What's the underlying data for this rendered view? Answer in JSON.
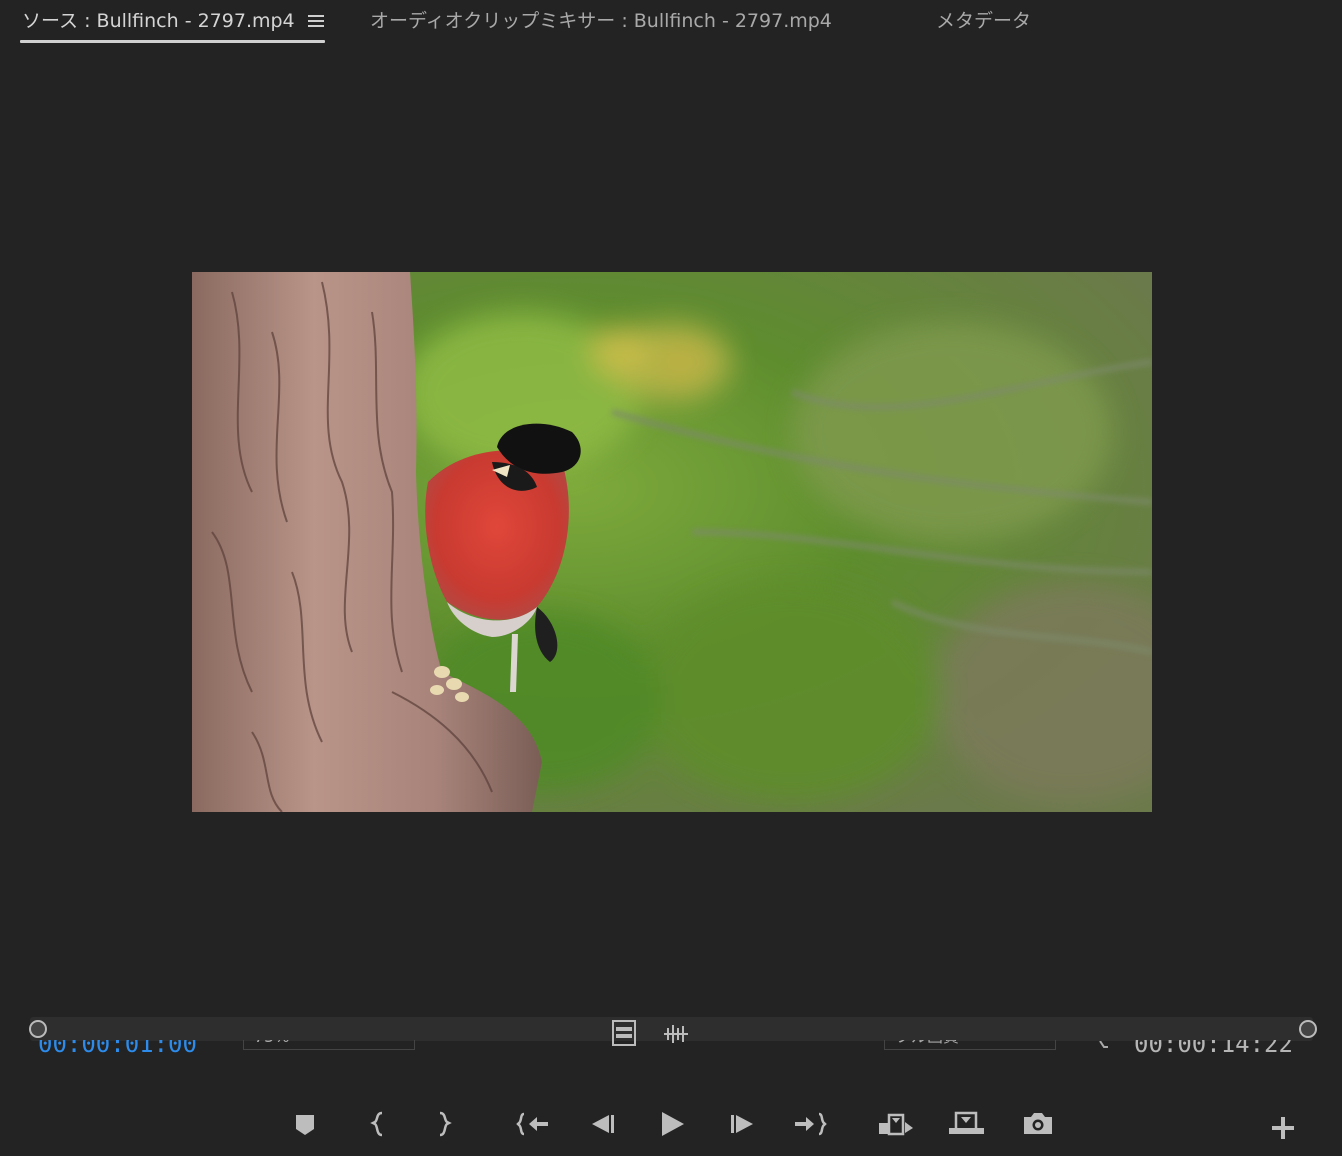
{
  "tabs": [
    {
      "label": "ソース : Bullfinch - 2797.mp4",
      "active": true
    },
    {
      "label": "オーディオクリップミキサー : Bullfinch - 2797.mp4",
      "active": false
    },
    {
      "label": "メタデータ",
      "active": false
    }
  ],
  "monitor": {
    "current_timecode": "00:00:01:00",
    "duration_timecode": "00:00:14:22",
    "zoom": "75%",
    "quality": "フル画質"
  },
  "icons": {
    "tab_menu": "hamburger-icon",
    "drag_video": "film-icon",
    "drag_audio": "waveform-icon",
    "controls": [
      "marker-icon",
      "mark-in-icon",
      "mark-out-icon",
      "go-to-in-icon",
      "step-back-icon",
      "play-icon",
      "step-forward-icon",
      "go-to-out-icon",
      "insert-icon",
      "overwrite-icon",
      "export-frame-icon",
      "add-button-icon"
    ]
  },
  "colors": {
    "background": "#232323",
    "timecode_accent": "#2d8ceb",
    "icon": "#bdbdbd"
  }
}
